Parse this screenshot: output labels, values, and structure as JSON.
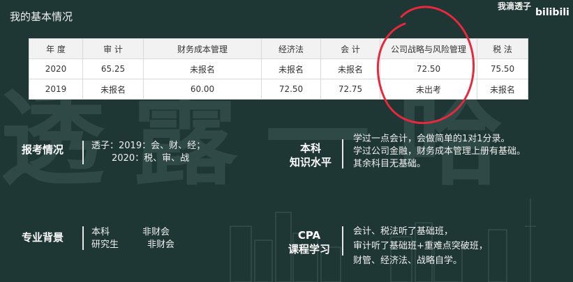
{
  "header": {
    "title": "我的基本情况",
    "brand": "我滴透子",
    "logo_text": "bilibili"
  },
  "watermark": "透露一哈",
  "score_table": {
    "headers": [
      "年 度",
      "审 计",
      "财务成本管理",
      "经济法",
      "会 计",
      "公司战略与风险管理",
      "税 法"
    ],
    "rows": [
      [
        "2020",
        "65.25",
        "未报名",
        "未报名",
        "未报名",
        "72.50",
        "75.50"
      ],
      [
        "2019",
        "未报名",
        "60.00",
        "72.50",
        "72.75",
        "未出考",
        "未报名"
      ]
    ]
  },
  "exam_registration": {
    "label": "报考情况",
    "lines": [
      "透子：2019：会、财、经；",
      "2020：税、审、战"
    ]
  },
  "undergrad_knowledge": {
    "label_line1": "本科",
    "label_line2": "知识水平",
    "lines": [
      "学过一点会计，会做简单的1对1分录。",
      "学过公司金融，财务成本管理上册有基础。",
      "其余科目无基础。"
    ]
  },
  "major_background": {
    "label": "专业背景",
    "rows": [
      {
        "degree": "本科",
        "major": "非财会"
      },
      {
        "degree": "研究生",
        "major": "非财会"
      }
    ]
  },
  "cpa_study": {
    "label_line1": "CPA",
    "label_line2": "课程学习",
    "lines": [
      "会计、税法听了基础班，",
      "审计听了基础班+重难点突破班，",
      "财管、经济法、战略自学。"
    ]
  },
  "colors": {
    "background": "#1f3734",
    "highlight_circle": "#e8283c"
  }
}
